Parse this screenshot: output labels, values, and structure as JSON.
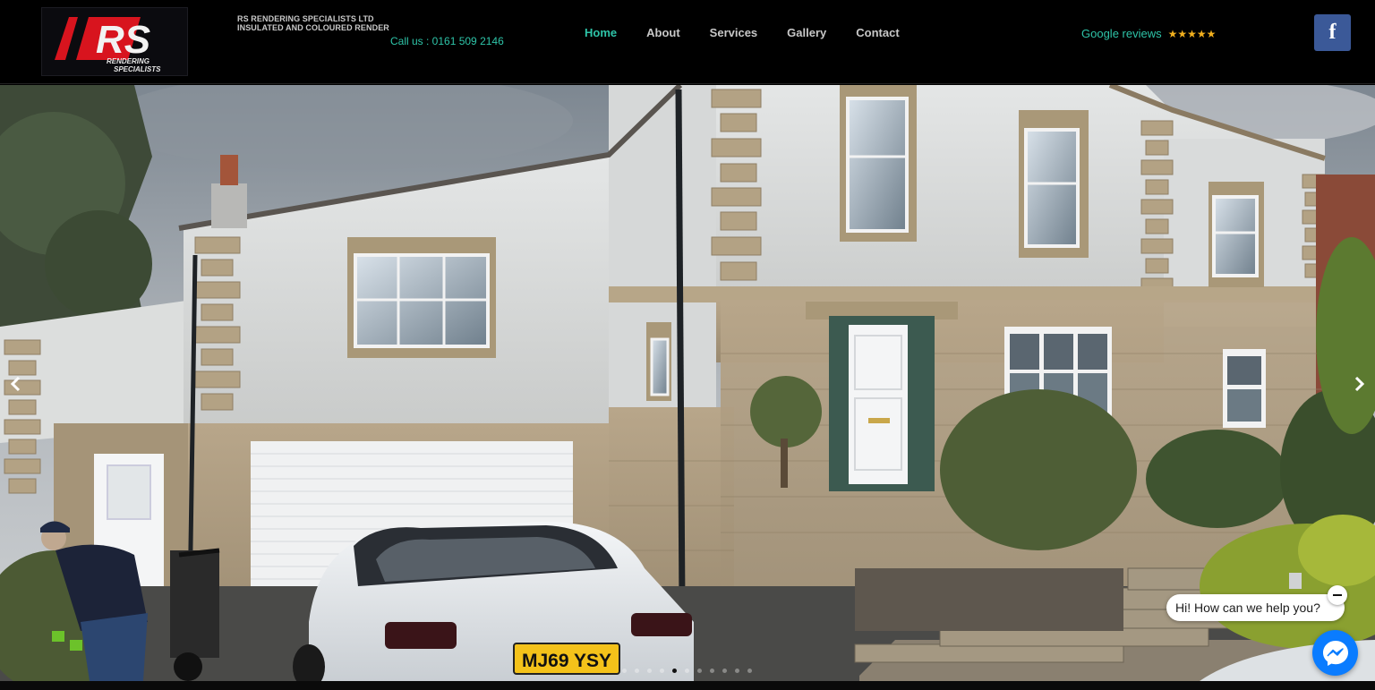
{
  "header": {
    "logo_text": "RS",
    "logo_subtitle_1": "RENDERING",
    "logo_subtitle_2": "SPECIALISTS",
    "company_name": "RS RENDERING SPECIALISTS LTD",
    "company_tagline": "INSULATED AND COLOURED RENDER",
    "phone": "Call us : 0161 509 2146"
  },
  "nav": {
    "items": [
      {
        "label": "Home",
        "active": true
      },
      {
        "label": "About",
        "active": false
      },
      {
        "label": "Services",
        "active": false
      },
      {
        "label": "Gallery",
        "active": false
      },
      {
        "label": "Contact",
        "active": false
      }
    ]
  },
  "reviews": {
    "label": "Google reviews",
    "stars": "★★★★★"
  },
  "social": {
    "facebook_label": "f",
    "facebook_icon": "facebook-icon"
  },
  "slider": {
    "image": "house-with-coloured-render-photo",
    "plate": "MJ69 YSY",
    "slide_count": 11,
    "active_slide": 4,
    "prev_icon": "chevron-left-icon",
    "next_icon": "chevron-right-icon"
  },
  "chat": {
    "prompt": "Hi! How can we help you?",
    "close_icon": "minus-icon",
    "messenger_icon": "messenger-icon"
  },
  "colors": {
    "accent": "#2ec4a8",
    "stars": "#f2b01e",
    "facebook": "#3b5998",
    "messenger": "#0a7cff",
    "logo_red": "#d8141e"
  }
}
